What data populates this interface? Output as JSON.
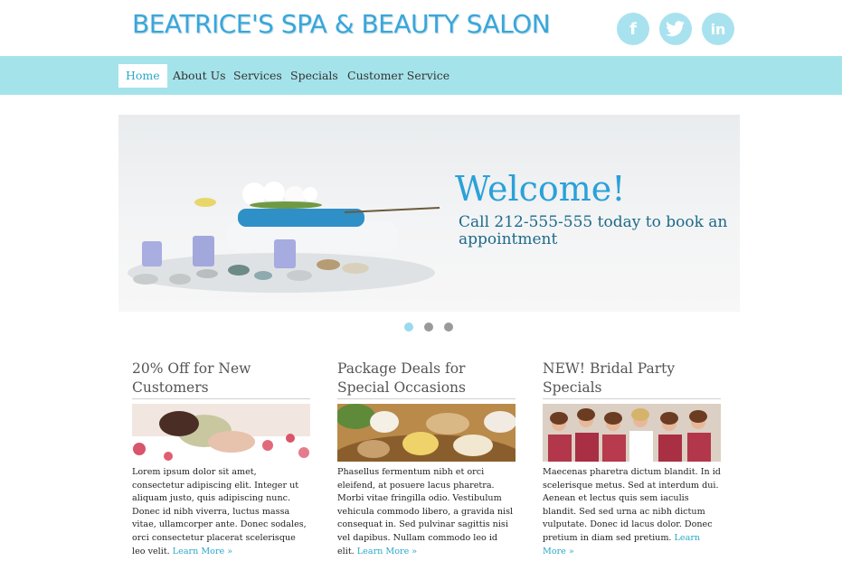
{
  "brand": {
    "title": "BEATRICE'S SPA & BEAUTY SALON"
  },
  "social": {
    "facebook": "f",
    "twitter": "t",
    "linkedin": "in"
  },
  "nav": {
    "items": [
      "Home",
      "About Us",
      "Services",
      "Specials",
      "Customer Service"
    ]
  },
  "hero": {
    "title": "Welcome!",
    "text": "Call 212-555-555 today to book an appointment"
  },
  "carousel": {
    "slide_count": 3,
    "active_index": 0
  },
  "features": [
    {
      "title": "20% Off for New Customers",
      "text": "Lorem ipsum dolor sit amet, consectetur adipiscing elit. Integer ut aliquam justo, quis adipiscing nunc. Donec id nibh viverra, luctus massa vitae, ullamcorper ante. Donec sodales, orci consectetur placerat scelerisque leo velit.",
      "link": "Learn More »"
    },
    {
      "title": "Package Deals for Special Occasions",
      "text": "Phasellus fermentum nibh et orci eleifend, at posuere lacus pharetra. Morbi vitae fringilla odio. Vestibulum vehicula commodo libero, a gravida nisl consequat in. Sed pulvinar sagittis nisi vel dapibus. Nullam commodo leo id elit.",
      "link": "Learn More »"
    },
    {
      "title": "NEW! Bridal Party Specials",
      "text": "Maecenas pharetra dictum blandit. In id scelerisque metus. Sed at interdum dui. Aenean et lectus quis sem iaculis blandit. Sed sed urna ac nibh dictum vulputate. Donec id lacus dolor. Donec pretium in diam sed pretium.",
      "link": "Learn More »"
    }
  ],
  "colors": {
    "accent": "#2aa7c9",
    "nav_bg": "#a5e3eb",
    "logo": "#3aa6d9"
  }
}
